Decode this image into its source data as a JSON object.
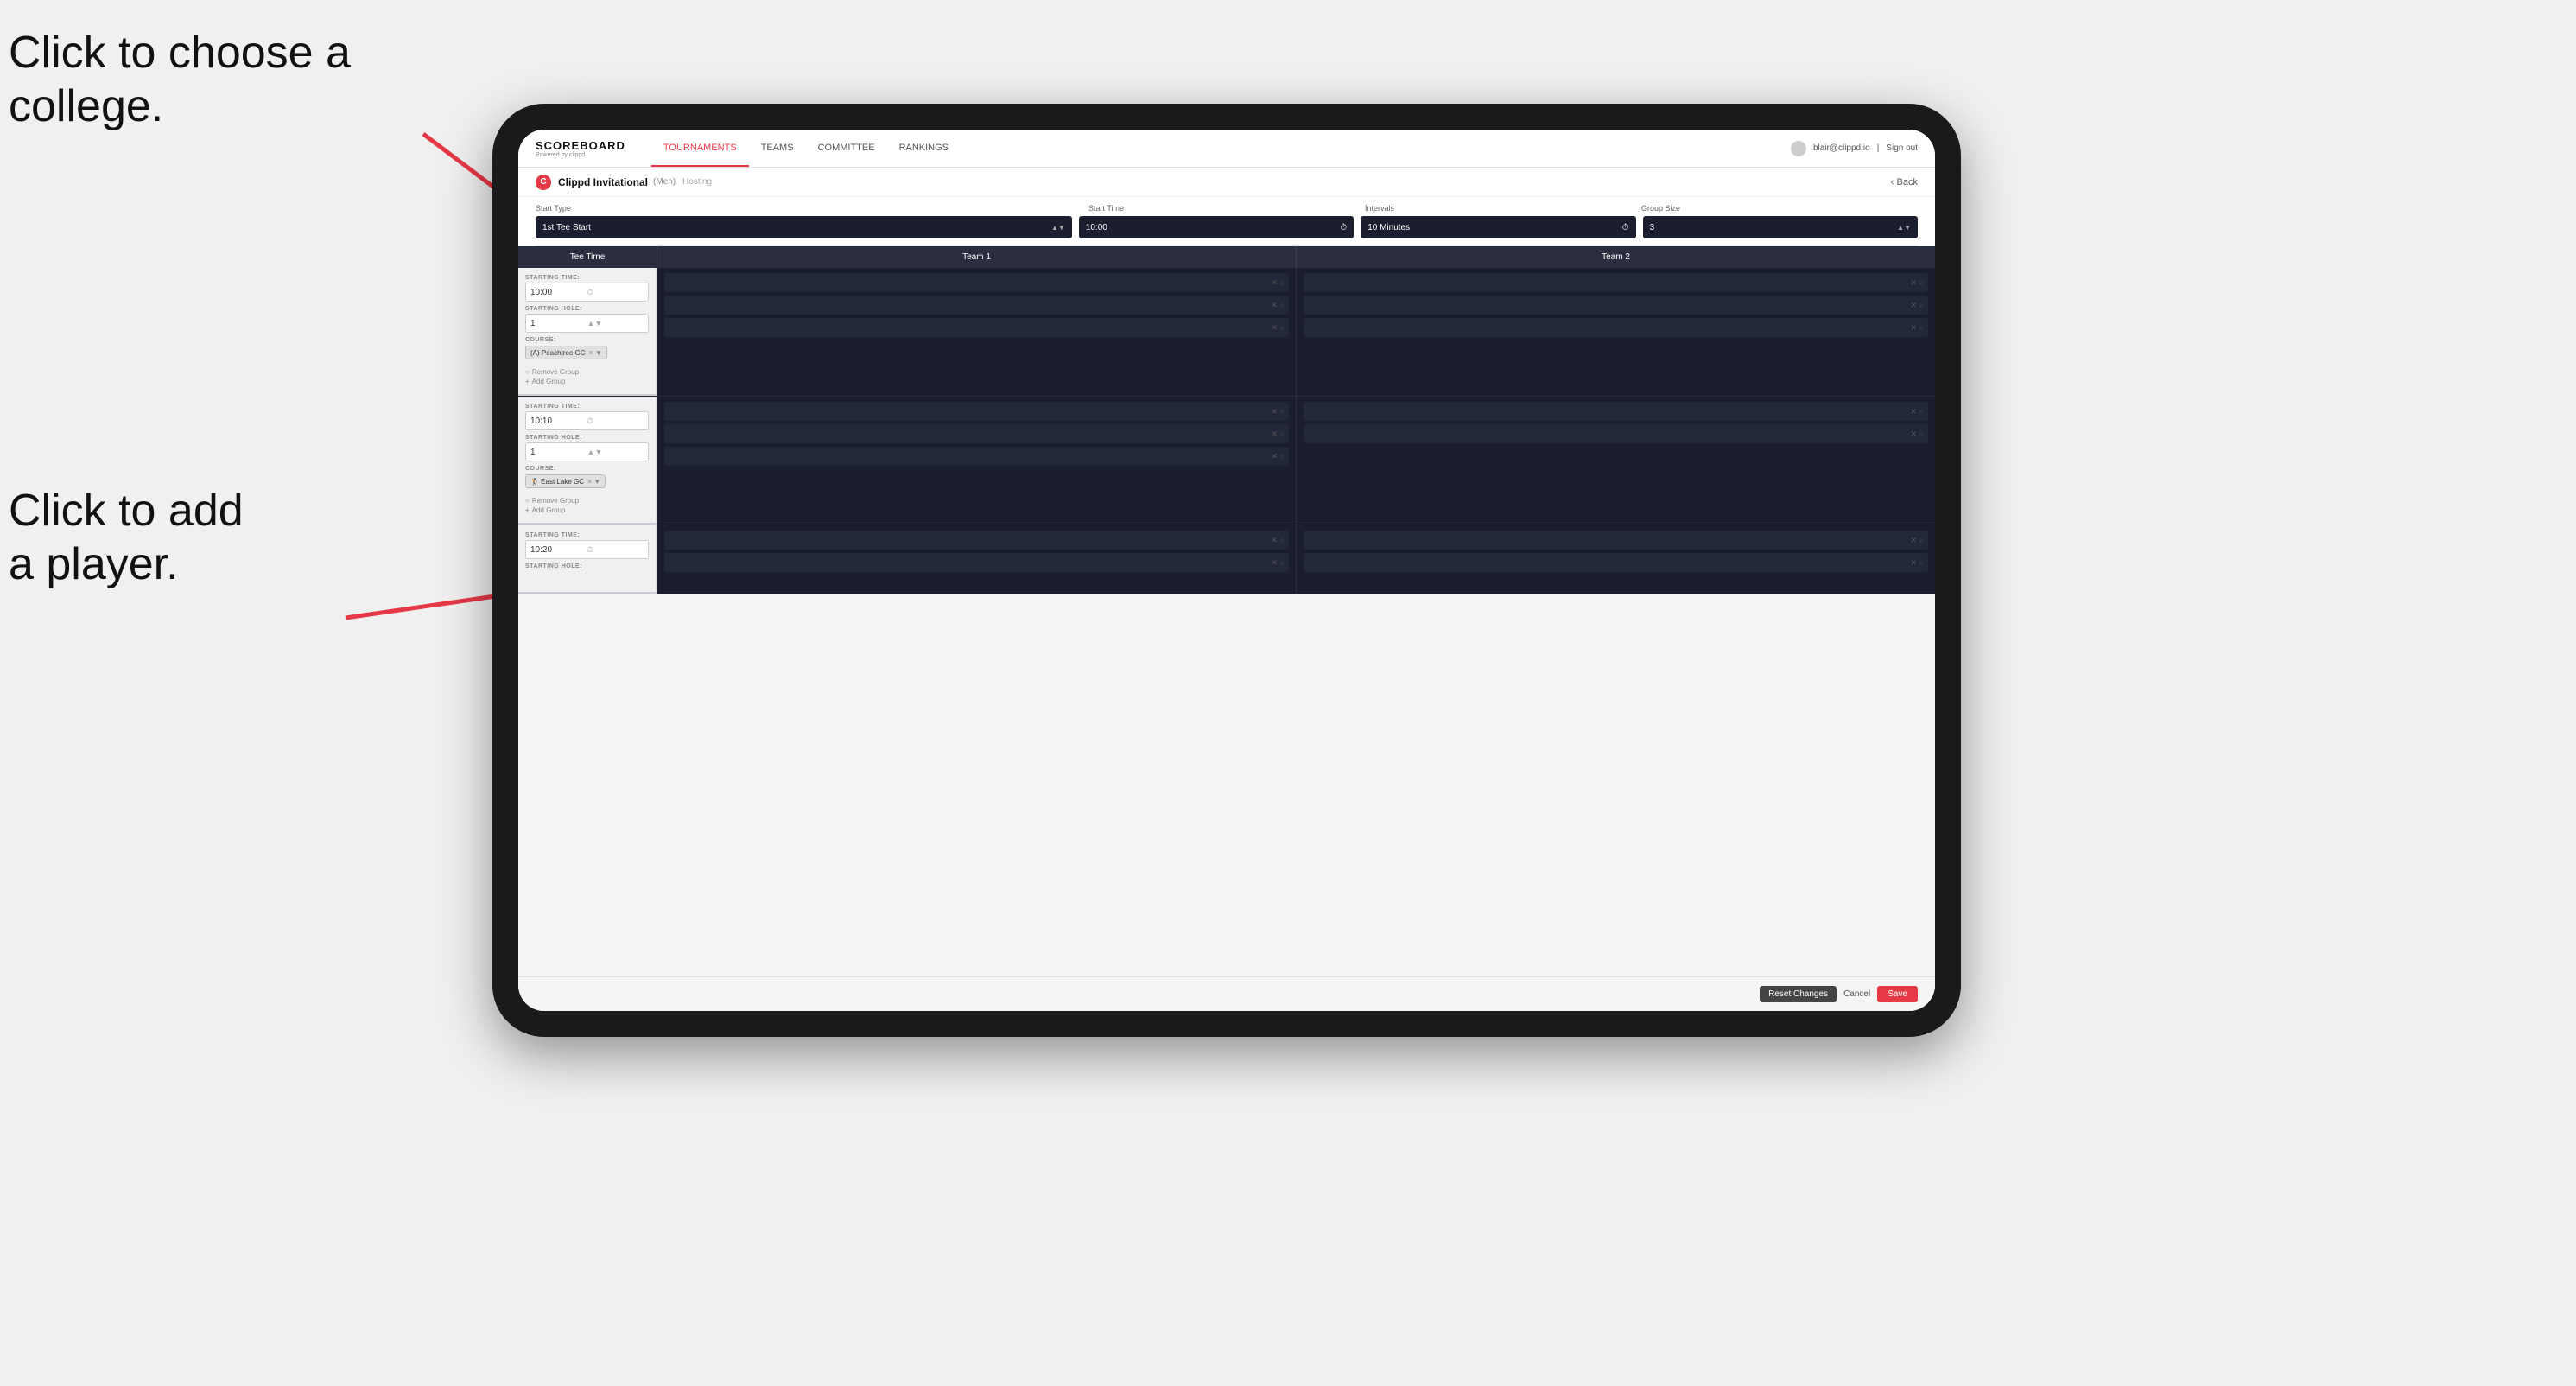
{
  "annotations": {
    "ann1": "Click to choose a\ncollege.",
    "ann2": "Click to add\na player."
  },
  "nav": {
    "logo": "SCOREBOARD",
    "logo_sub": "Powered by clippd",
    "tabs": [
      "TOURNAMENTS",
      "TEAMS",
      "COMMITTEE",
      "RANKINGS"
    ],
    "active_tab": "TOURNAMENTS",
    "user_email": "blair@clippd.io",
    "sign_out": "Sign out"
  },
  "sub_header": {
    "logo_letter": "C",
    "title": "Clippd Invitational",
    "badge": "(Men)",
    "tag": "Hosting",
    "back": "Back"
  },
  "controls": {
    "start_type_label": "Start Type",
    "start_time_label": "Start Time",
    "intervals_label": "Intervals",
    "group_size_label": "Group Size",
    "start_type_value": "1st Tee Start",
    "start_time_value": "10:00",
    "intervals_value": "10 Minutes",
    "group_size_value": "3"
  },
  "table": {
    "col_tee": "Tee Time",
    "col_team1": "Team 1",
    "col_team2": "Team 2"
  },
  "groups": [
    {
      "starting_time": "10:00",
      "starting_hole": "1",
      "course": "(A) Peachtree GC",
      "team1_slots": 2,
      "team2_slots": 2,
      "has_course": true,
      "links": [
        "Remove Group",
        "+ Add Group"
      ]
    },
    {
      "starting_time": "10:10",
      "starting_hole": "1",
      "course": "East Lake GC",
      "team1_slots": 2,
      "team2_slots": 2,
      "has_course": true,
      "links": [
        "Remove Group",
        "+ Add Group"
      ]
    },
    {
      "starting_time": "10:20",
      "starting_hole": "",
      "course": "",
      "team1_slots": 2,
      "team2_slots": 2,
      "has_course": false,
      "links": []
    }
  ],
  "footer": {
    "reset": "Reset Changes",
    "cancel": "Cancel",
    "save": "Save"
  }
}
